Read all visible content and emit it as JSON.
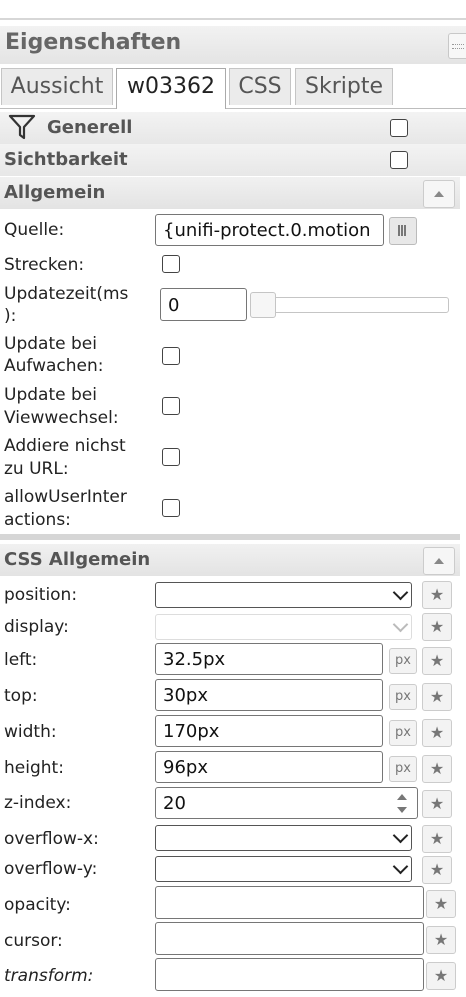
{
  "panel": {
    "title": "Eigenschaften"
  },
  "tabs": [
    {
      "label": "Aussicht"
    },
    {
      "label": "w03362"
    },
    {
      "label": "CSS"
    },
    {
      "label": "Skripte"
    }
  ],
  "filter_row": {
    "label": "Generell"
  },
  "visibility_row": {
    "label": "Sichtbarkeit"
  },
  "general_section": {
    "header": "Allgemein",
    "source": {
      "label": "Quelle:",
      "value": "{unifi-protect.0.motion"
    },
    "stretch": {
      "label": "Strecken:"
    },
    "update_time": {
      "label_1": "Updatezeit(ms",
      "label_2": "):",
      "value": "0"
    },
    "update_wake": {
      "label_1": "Update bei",
      "label_2": "Aufwachen:"
    },
    "update_view": {
      "label_1": "Update bei",
      "label_2": "Viewwechsel:"
    },
    "add_url": {
      "label_1": "Addiere nichst",
      "label_2": "zu URL:"
    },
    "allow_user": {
      "label_1": "allowUserInter",
      "label_2": "actions:"
    }
  },
  "css_section": {
    "header": "CSS Allgemein",
    "unit": "px",
    "rows": {
      "position": {
        "label": "position:",
        "value": ""
      },
      "display": {
        "label": "display:",
        "value": ""
      },
      "left": {
        "label": "left:",
        "value": "32.5px"
      },
      "top": {
        "label": "top:",
        "value": "30px"
      },
      "width": {
        "label": "width:",
        "value": "170px"
      },
      "height": {
        "label": "height:",
        "value": "96px"
      },
      "z_index": {
        "label": "z-index:",
        "value": "20"
      },
      "overflow_x": {
        "label": "overflow-x:",
        "value": ""
      },
      "overflow_y": {
        "label": "overflow-y:",
        "value": ""
      },
      "opacity": {
        "label": "opacity:",
        "value": ""
      },
      "cursor": {
        "label": "cursor:",
        "value": ""
      },
      "transform": {
        "label": "transform:",
        "value": ""
      }
    }
  },
  "icons": {
    "star": "★"
  }
}
